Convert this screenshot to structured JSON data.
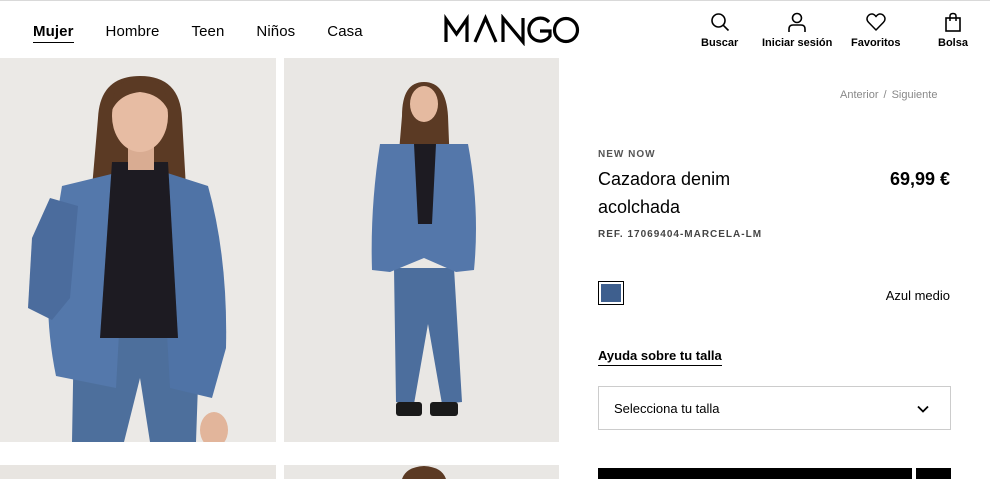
{
  "header": {
    "nav": [
      {
        "label": "Mujer",
        "active": true
      },
      {
        "label": "Hombre"
      },
      {
        "label": "Teen"
      },
      {
        "label": "Niños"
      },
      {
        "label": "Casa"
      }
    ],
    "logo": "MANGO",
    "actions": {
      "search": {
        "label": "Buscar",
        "icon": "search-icon"
      },
      "login": {
        "label": "Iniciar sesión",
        "icon": "user-icon"
      },
      "favorites": {
        "label": "Favoritos",
        "icon": "heart-icon"
      },
      "bag": {
        "label": "Bolsa",
        "icon": "bag-icon"
      }
    }
  },
  "breadcrumb": {
    "prev": "Anterior",
    "separator": "/",
    "next": "Siguiente"
  },
  "product": {
    "tag": "NEW NOW",
    "name": "Cazadora denim acolchada",
    "price": "69,99 €",
    "ref": "REF. 17069404-MARCELA-LM",
    "color": {
      "name": "Azul medio",
      "swatch": "#3e5f8e"
    },
    "size_help": "Ayuda sobre tu talla",
    "size_select_placeholder": "Selecciona tu talla"
  },
  "colors": {
    "accent": "#000000",
    "muted": "#888888",
    "photo_bg": "#eae8e4",
    "denim": "#4a6fa5"
  }
}
